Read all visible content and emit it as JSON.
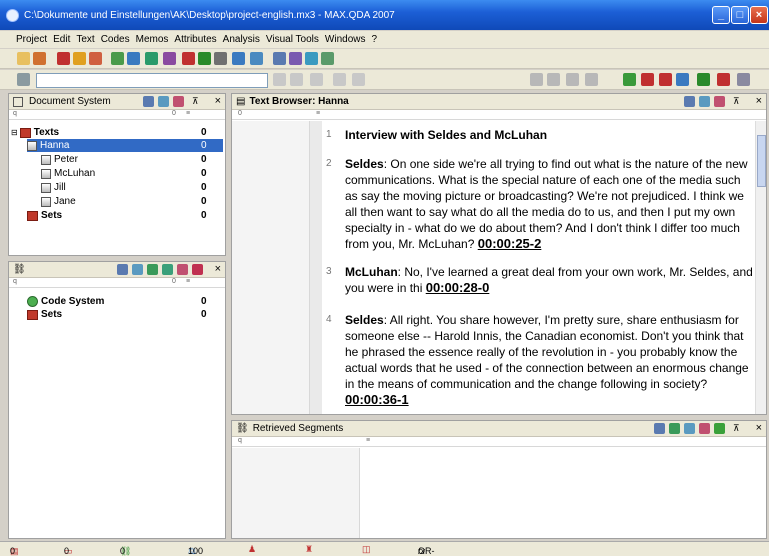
{
  "window": {
    "title": "C:\\Dokumente und Einstellungen\\AK\\Desktop\\project-english.mx3 - MAX.QDA 2007"
  },
  "menu": [
    "Project",
    "Edit",
    "Text",
    "Codes",
    "Memos",
    "Attributes",
    "Analysis",
    "Visual Tools",
    "Windows",
    "?"
  ],
  "document_system": {
    "title": "Document System",
    "col1": "q",
    "col2": "0",
    "col3": "≡",
    "items": [
      {
        "label": "Texts",
        "count": "0"
      },
      {
        "label": "Hanna",
        "count": "0"
      },
      {
        "label": "Peter",
        "count": "0"
      },
      {
        "label": "McLuhan",
        "count": "0"
      },
      {
        "label": "Jill",
        "count": "0"
      },
      {
        "label": "Jane",
        "count": "0"
      },
      {
        "label": "Sets",
        "count": "0"
      }
    ]
  },
  "code_system": {
    "col1": "q",
    "col2": "0",
    "col3": "≡",
    "items": [
      {
        "label": "Code System",
        "count": "0"
      },
      {
        "label": "Sets",
        "count": "0"
      }
    ]
  },
  "text_browser": {
    "title": "Text Browser: Hanna",
    "col1": "0",
    "col2": "≡",
    "paragraphs": [
      {
        "num": "1",
        "speaker": "Interview with Seldes and McLuhan",
        "text": "",
        "code": ""
      },
      {
        "num": "2",
        "speaker": "Seldes",
        "text": ": On one side we're all trying to find out what is the nature of the new communications. What is the special nature of each one of the media such as say the moving picture or broadcasting? We're not prejudiced. I think we all then want to say what do all the media do to us, and then I put my own specialty in - what do we do about them? And I don't think I differ too much from you, Mr. McLuhan?",
        "code": "00:00:25-2"
      },
      {
        "num": "3",
        "speaker": "McLuhan",
        "text": ": No, I've learned a great deal from your own work, Mr. Seldes, and you were in thi",
        "code": "00:00:28-0"
      },
      {
        "num": "4",
        "speaker": "Seldes",
        "text": ": All right. You share however, I'm pretty sure, share enthusiasm for someone else -- Harold Innis, the Canadian economist. Don't you think that he phrased the essence really of the revolution in - you probably know the actual words that he used - of the connection between an enormous change in the means of communication and the change following in society?",
        "code": "00:00:36-1"
      }
    ]
  },
  "retrieved_segments": {
    "title": "Retrieved Segments",
    "col1": "q",
    "col2": "≡"
  },
  "status": {
    "s1": "0",
    "s2": "0",
    "s3": "0",
    "s4": "100",
    "combo": "OR-Combination"
  },
  "colors": {
    "accent": "#316ac5",
    "titlebar": "#1c5fd6"
  }
}
